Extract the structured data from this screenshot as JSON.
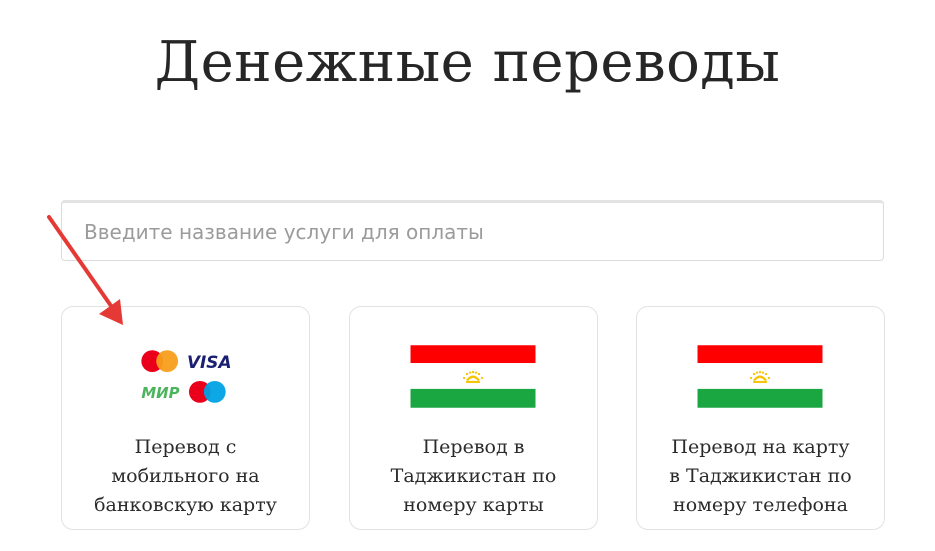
{
  "page": {
    "title": "Денежные переводы"
  },
  "search": {
    "placeholder": "Введите название услуги для оплаты",
    "value": ""
  },
  "cards": [
    {
      "label_lines": [
        "Перевод с",
        "мобильного на",
        "банковскую карту"
      ],
      "logos": [
        "mastercard-logo",
        "visa-logo",
        "mir-logo",
        "maestro-logo"
      ],
      "visa_text": "VISA",
      "mir_text": "МИР"
    },
    {
      "label_lines": [
        "Перевод в",
        "Таджикистан по",
        "номеру карты"
      ],
      "logos": [
        "tajikistan-flag-icon"
      ]
    },
    {
      "label_lines": [
        "Перевод на карту",
        "в Таджикистан по",
        "номеру телефона"
      ],
      "logos": [
        "tajikistan-flag-icon"
      ]
    }
  ],
  "colors": {
    "arrow": "#e53935",
    "flag_red": "#ff0000",
    "flag_white": "#ffffff",
    "flag_green": "#1aa640",
    "flag_emblem": "#f8c300",
    "mastercard_red": "#eb001b",
    "mastercard_orange": "#f79e1b",
    "maestro_blue": "#00a2e5",
    "visa_blue": "#1a1f71",
    "mir_green": "#4db45e"
  }
}
